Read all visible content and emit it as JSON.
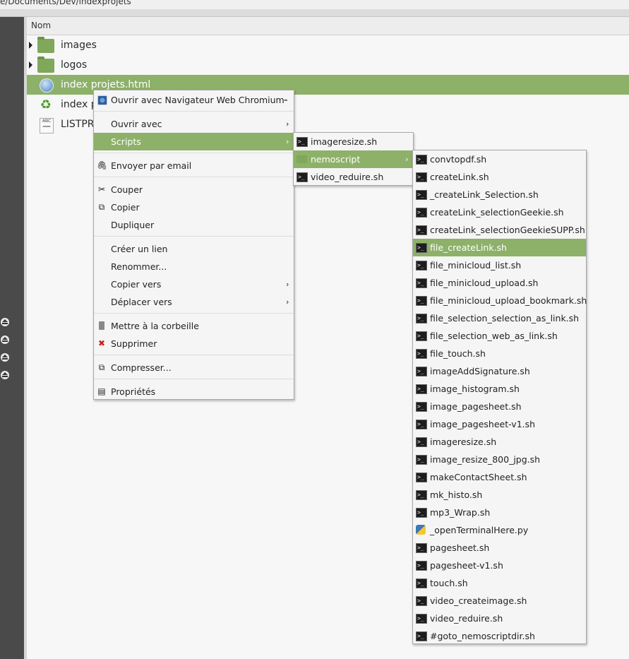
{
  "path": "e/Documents/Dev/indexprojets",
  "header": {
    "col_name": "Nom"
  },
  "files": [
    {
      "name": "images",
      "type": "folder",
      "expandable": true
    },
    {
      "name": "logos",
      "type": "folder",
      "expandable": true
    },
    {
      "name": "index projets.html",
      "type": "html",
      "selected": true
    },
    {
      "name": "index p",
      "type": "recycle"
    },
    {
      "name": "LISTPR",
      "type": "text"
    }
  ],
  "context_menu": {
    "open_with_app": "Ouvrir avec Navigateur Web Chromium",
    "open_with": "Ouvrir avec",
    "scripts": "Scripts",
    "send_email": "Envoyer par email",
    "cut": "Couper",
    "copy": "Copier",
    "duplicate": "Dupliquer",
    "create_link": "Créer un lien",
    "rename": "Renommer...",
    "copy_to": "Copier vers",
    "move_to": "Déplacer vers",
    "trash": "Mettre à la corbeille",
    "delete": "Supprimer",
    "compress": "Compresser...",
    "properties": "Propriétés"
  },
  "scripts_menu": {
    "items": [
      "imageresize.sh",
      "nemoscript",
      "video_reduire.sh"
    ],
    "highlighted": "nemoscript"
  },
  "nemoscript_menu": {
    "items": [
      "convtopdf.sh",
      "createLink.sh",
      "_createLink_Selection.sh",
      "createLink_selectionGeekie.sh",
      "createLink_selectionGeekieSUPP.sh",
      "file_createLink.sh",
      "file_minicloud_list.sh",
      "file_minicloud_upload.sh",
      "file_minicloud_upload_bookmark.sh",
      "file_selection_selection_as_link.sh",
      "file_selection_web_as_link.sh",
      "file_touch.sh",
      "imageAddSignature.sh",
      "image_histogram.sh",
      "image_pagesheet.sh",
      "image_pagesheet-v1.sh",
      "imageresize.sh",
      "image_resize_800_jpg.sh",
      "makeContactSheet.sh",
      "mk_histo.sh",
      "mp3_Wrap.sh",
      "_openTerminalHere.py",
      "pagesheet.sh",
      "pagesheet-v1.sh",
      "touch.sh",
      "video_createimage.sh",
      "video_reduire.sh",
      "#goto_nemoscriptdir.sh"
    ],
    "highlighted": "file_createLink.sh"
  },
  "colors": {
    "selection": "#8db169",
    "sidebar": "#4a4a4a"
  }
}
